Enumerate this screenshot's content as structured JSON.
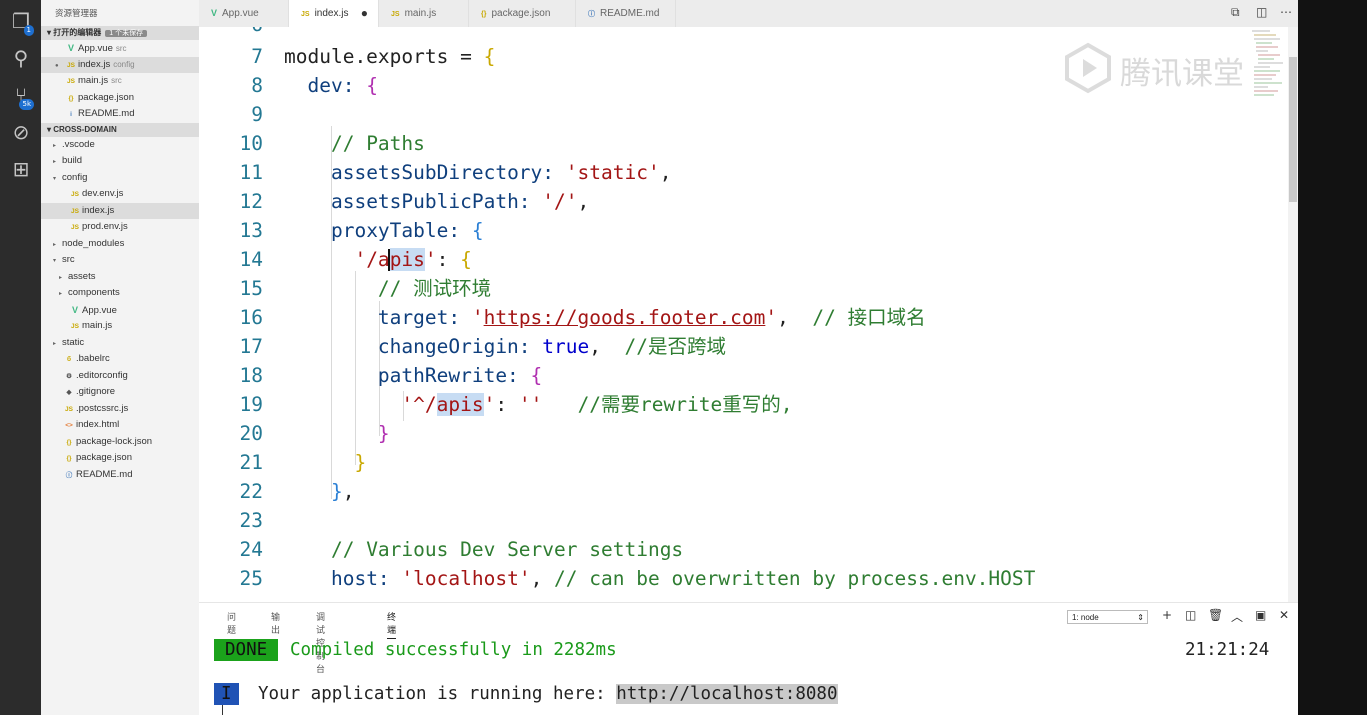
{
  "activity_bar": {
    "items": [
      {
        "name": "explorer",
        "icon": "files-icon",
        "badge": "1"
      },
      {
        "name": "search",
        "icon": "search-icon"
      },
      {
        "name": "source-control",
        "icon": "git-icon",
        "badge": "5k"
      },
      {
        "name": "debug",
        "icon": "debug-icon"
      },
      {
        "name": "extensions",
        "icon": "extensions-icon"
      }
    ]
  },
  "sidebar": {
    "title": "资源管理器",
    "open_editors": {
      "label": "打开的编辑器",
      "badge": "1 个未保存",
      "items": [
        {
          "icon": "V",
          "label": "App.vue",
          "sub": "src"
        },
        {
          "icon": "JS",
          "label": "index.js",
          "sub": "config"
        },
        {
          "icon": "JS",
          "label": "main.js",
          "sub": "src"
        },
        {
          "icon": "{}",
          "label": "package.json",
          "sub": ""
        },
        {
          "icon": "i",
          "label": "README.md",
          "sub": ""
        }
      ]
    },
    "project": {
      "label": "CROSS-DOMAIN",
      "items": [
        {
          "arrow": "▸",
          "icon": "",
          "label": ".vscode"
        },
        {
          "arrow": "▸",
          "icon": "",
          "label": "build"
        },
        {
          "arrow": "▾",
          "icon": "",
          "label": "config"
        },
        {
          "arrow": "",
          "icon": "JS",
          "label": "dev.env.js"
        },
        {
          "arrow": "",
          "icon": "JS",
          "label": "index.js"
        },
        {
          "arrow": "",
          "icon": "JS",
          "label": "prod.env.js"
        },
        {
          "arrow": "▸",
          "icon": "",
          "label": "node_modules"
        },
        {
          "arrow": "▾",
          "icon": "",
          "label": "src"
        },
        {
          "arrow": "▸",
          "icon": "",
          "label": "assets"
        },
        {
          "arrow": "▸",
          "icon": "",
          "label": "components"
        },
        {
          "arrow": "",
          "icon": "V",
          "label": "App.vue"
        },
        {
          "arrow": "",
          "icon": "JS",
          "label": "main.js"
        },
        {
          "arrow": "▸",
          "icon": "",
          "label": "static"
        },
        {
          "arrow": "",
          "icon": "б",
          "label": ".babelrc"
        },
        {
          "arrow": "",
          "icon": "⚙",
          "label": ".editorconfig"
        },
        {
          "arrow": "",
          "icon": "◆",
          "label": ".gitignore"
        },
        {
          "arrow": "",
          "icon": "JS",
          "label": ".postcssrc.js"
        },
        {
          "arrow": "",
          "icon": "<>",
          "label": "index.html"
        },
        {
          "arrow": "",
          "icon": "{}",
          "label": "package-lock.json"
        },
        {
          "arrow": "",
          "icon": "{}",
          "label": "package.json"
        },
        {
          "arrow": "",
          "icon": "ⓘ",
          "label": "README.md"
        }
      ]
    }
  },
  "tabs": [
    {
      "icon": "V",
      "label": "App.vue"
    },
    {
      "icon": "JS",
      "label": "index.js"
    },
    {
      "icon": "JS",
      "label": "main.js"
    },
    {
      "icon": "{}",
      "label": "package.json"
    },
    {
      "icon": "ⓘ",
      "label": "README.md"
    }
  ],
  "editor": {
    "top_partial_line_number": "6",
    "line_numbers": [
      "7",
      "8",
      "9",
      "10",
      "11",
      "12",
      "13",
      "14",
      "15",
      "16",
      "17",
      "18",
      "19",
      "20",
      "21",
      "22",
      "23",
      "24",
      "25"
    ],
    "watermark": "腾讯课堂",
    "tokens": {
      "l7_a": "module.exports = ",
      "l8_a": "dev: ",
      "l10": "// Paths",
      "l11_k": "assetsSubDirectory: ",
      "l11_v": "'static'",
      "l12_k": "assetsPublicPath: ",
      "l12_v": "'/'",
      "l13_k": "proxyTable: ",
      "l14_q1": "'/a",
      "l14_sel": "pis",
      "l14_q2": "'",
      "l15": "// 测试环境",
      "l16_k": "target: ",
      "l16_q1": "'",
      "l16_url": "https://goods.footer.com",
      "l16_q2": "'",
      "l16_c": "// 接口域名",
      "l17_k": "changeOrigin: ",
      "l17_v": "true",
      "l17_c": "//是否跨域",
      "l18_k": "pathRewrite: ",
      "l19_q1": "'^/",
      "l19_hl": "apis",
      "l19_q2": "'",
      "l19_v": "''",
      "l19_c": "//需要rewrite重写的,",
      "l24": "// Various Dev Server settings",
      "l25_k": "host: ",
      "l25_v": "'localhost'",
      "l25_c": "// can be overwritten by process.env.HOST"
    }
  },
  "panel": {
    "tabs": [
      "问题",
      "输出",
      "调试控制台",
      "终端"
    ],
    "terminal_select": "1: node",
    "done_badge": "DONE",
    "done_message": "Compiled successfully in 2282ms",
    "timestamp": "21:21:24",
    "info_badge": "I",
    "run_message": "Your application is running here: ",
    "run_url": "http://localhost:8080"
  }
}
